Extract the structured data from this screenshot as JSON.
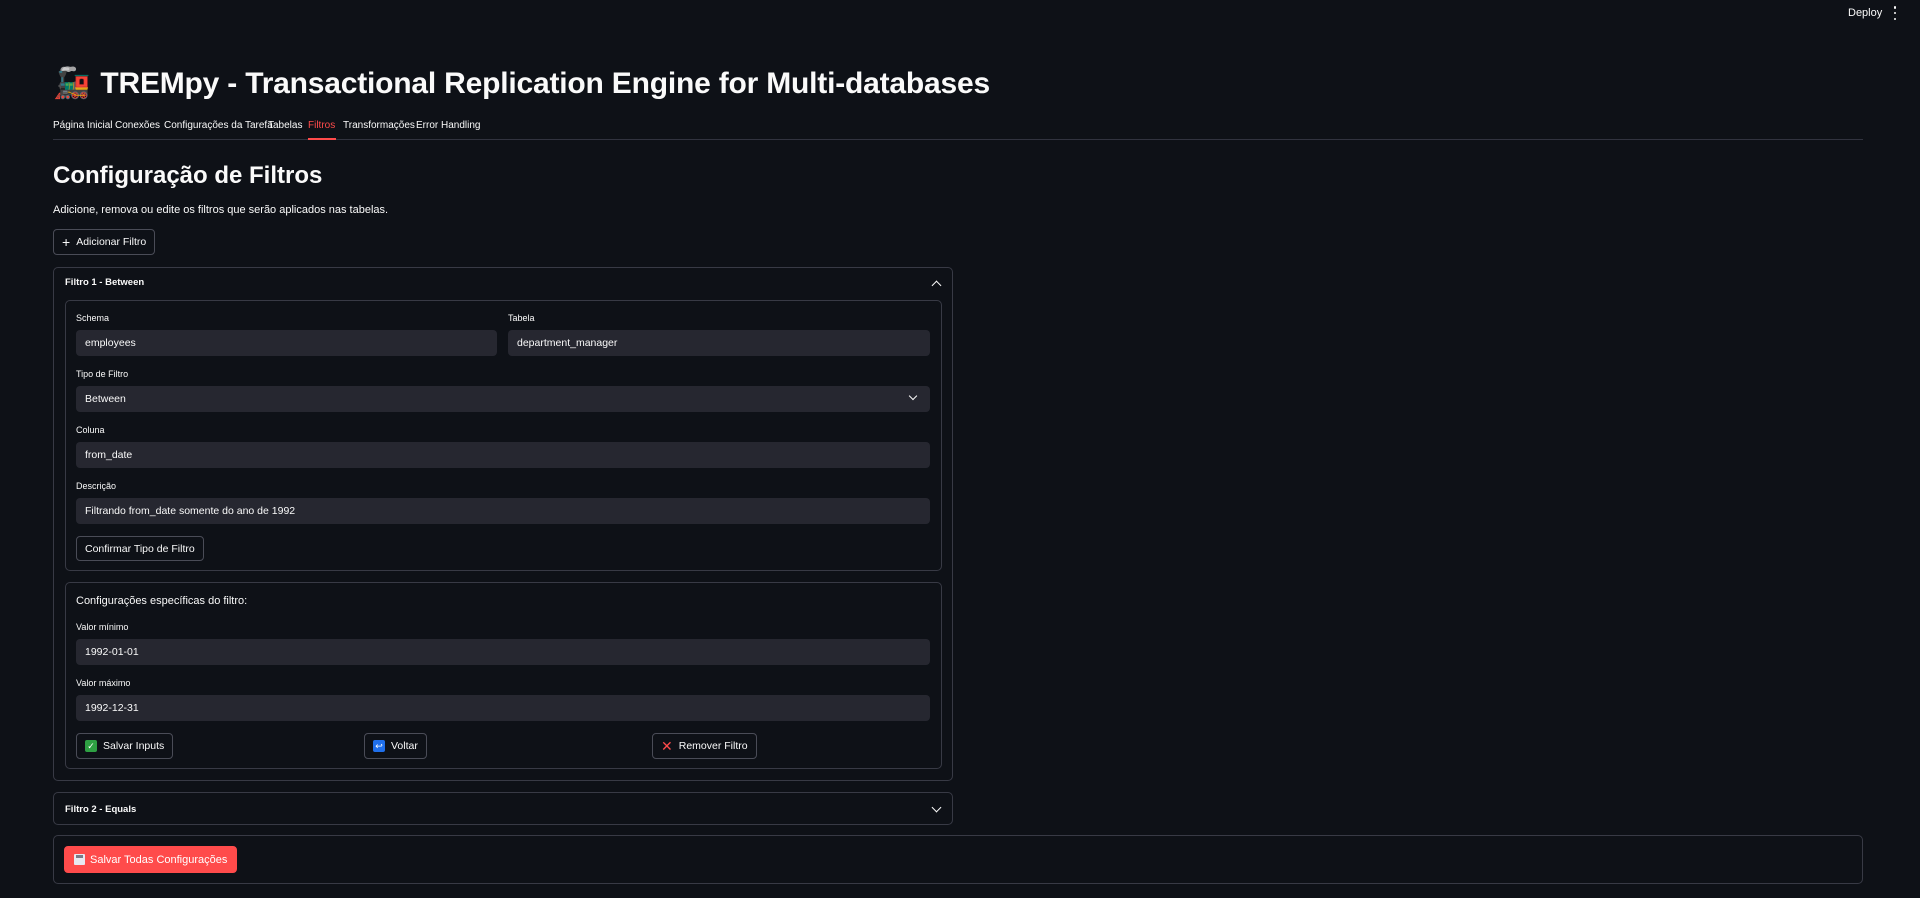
{
  "topbar": {
    "deploy_label": "Deploy",
    "menu_icon": "kebab-menu-icon"
  },
  "header": {
    "icon": "🚂",
    "title": "TREMpy - Transactional Replication Engine for Multi-databases"
  },
  "tabs": [
    {
      "label": "Página Inicial",
      "active": false
    },
    {
      "label": "Conexões",
      "active": false
    },
    {
      "label": "Configurações da Tarefa",
      "active": false
    },
    {
      "label": "Tabelas",
      "active": false
    },
    {
      "label": "Filtros",
      "active": true
    },
    {
      "label": "Transformações",
      "active": false
    },
    {
      "label": "Error Handling",
      "active": false
    }
  ],
  "page": {
    "heading": "Configuração de Filtros",
    "description": "Adicione, remova ou edite os filtros que serão aplicados nas tabelas.",
    "add_filter_label": "Adicionar Filtro"
  },
  "filters": [
    {
      "header": "Filtro 1 - Between",
      "expanded": true,
      "schema_label": "Schema",
      "schema_value": "employees",
      "table_label": "Tabela",
      "table_value": "department_manager",
      "type_label": "Tipo de Filtro",
      "type_value": "Between",
      "column_label": "Coluna",
      "column_value": "from_date",
      "description_label": "Descrição",
      "description_value": "Filtrando from_date somente do ano de 1992",
      "confirm_label": "Confirmar Tipo de Filtro",
      "specific_title": "Configurações específicas do filtro:",
      "min_label": "Valor mínimo",
      "min_value": "1992-01-01",
      "max_label": "Valor máximo",
      "max_value": "1992-12-31",
      "save_inputs_label": "Salvar Inputs",
      "back_label": "Voltar",
      "remove_label": "Remover Filtro"
    },
    {
      "header": "Filtro 2 - Equals",
      "expanded": false
    }
  ],
  "footer": {
    "save_all_label": "Salvar Todas Configurações"
  },
  "colors": {
    "background": "#0e1117",
    "accent": "#ff4b4b",
    "input_bg": "#262730",
    "border": "#383a45"
  }
}
